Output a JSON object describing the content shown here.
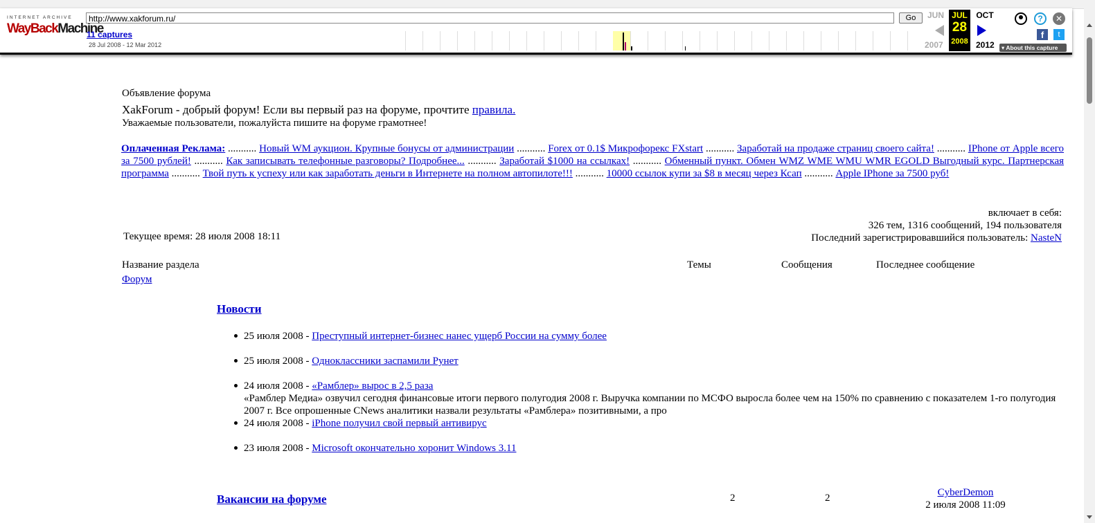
{
  "wayback": {
    "logo_top": "INTERNET ARCHIVE",
    "logo_left": "WayBack",
    "logo_right": "Machine",
    "url": "http://www.xakforum.ru/",
    "go_label": "Go",
    "captures_label": "11 captures",
    "range": "28 Jul 2008 - 12 Mar 2012",
    "prev_month": "JUN",
    "cur_month": "JUL",
    "cur_day": "28",
    "cur_year": "2008",
    "next_month": "OCT",
    "prev_year": "2007",
    "next_year": "2012",
    "about": "About this capture",
    "help_icon_text": "?",
    "close_icon_text": "✕",
    "fb_text": "f",
    "tw_text": "t"
  },
  "announcement": {
    "title": "Объявление форума",
    "main_prefix": "XakForum",
    "main_text": " - добрый форум! Если вы первый раз на форуме, прочтите ",
    "rules_link": "правила.",
    "sub": "Уважаемые пользователи, пожалуйста пишите на форуме грамотнее!"
  },
  "ads": {
    "label": "Оплаченная Реклама:",
    "separator": " ........... ",
    "links": [
      "Новый WM аукцион. Крупные бонусы от администрации",
      "Forex от 0.1$ Микрофорекс FXstart",
      "Заработай на продаже страниц своего сайта!",
      "IPhone от Apple всего за 7500 рублей!",
      "Как записывать телефонные разговоры? Подробнее...",
      "Заработай $1000 на ссылках!",
      "Обменный пункт. Обмен WMZ WME WMU WMR EGOLD Выгодный курс. Партнерская программа",
      "Твой путь к успеху или как заработать деньги в Интернете на полном автопилоте!!!",
      "10000 ссылок купи за $8 в месяц через Ксап",
      "Apple IPhone за 7500 руб!"
    ]
  },
  "stats": {
    "includes": "включает в себя:",
    "counts": "326 тем, 1316 сообщений, 194 пользователя",
    "last_user_label": "Последний зарегистрировавшийся пользователь: ",
    "last_user": "NasteN"
  },
  "current_time": "Текущее время: 28 июля 2008 18:11",
  "table_headers": {
    "section": "Название раздела",
    "topics": "Темы",
    "messages": "Сообщения",
    "last": "Последнее сообщение"
  },
  "forum_link": "Форум",
  "news_section": {
    "title": "Новости",
    "items": [
      {
        "date": "25 июля 2008 - ",
        "title": "Преступный интернет-бизнес нанес ущерб России на сумму более",
        "excerpt": ""
      },
      {
        "date": "25 июля 2008 - ",
        "title": "Одноклассники заспамили Рунет",
        "excerpt": ""
      },
      {
        "date": "24 июля 2008 - ",
        "title": "«Рамблер» вырос в 2,5 раза",
        "excerpt": "«Рамблер Медиа» озвучил сегодня финансовые итоги первого полугодия 2008 г. Выручка компании по МСФО выросла более чем на 150% по сравнению с показателем 1-го полугодия 2007 г. Все опрошенные CNews аналитики назвали результаты «Рамблера» позитивными, а про"
      },
      {
        "date": "24 июля 2008 - ",
        "title": "iPhone получил свой первый антивирус",
        "excerpt": ""
      },
      {
        "date": "23 июля 2008 - ",
        "title": "Microsoft окончательно хоронит Windows 3.11",
        "excerpt": ""
      }
    ]
  },
  "vacancies_row": {
    "title": "Вакансии на форуме",
    "topics": "2",
    "messages": "2",
    "last_user": "CyberDemon",
    "last_date": "2 июля 2008 11:09"
  }
}
